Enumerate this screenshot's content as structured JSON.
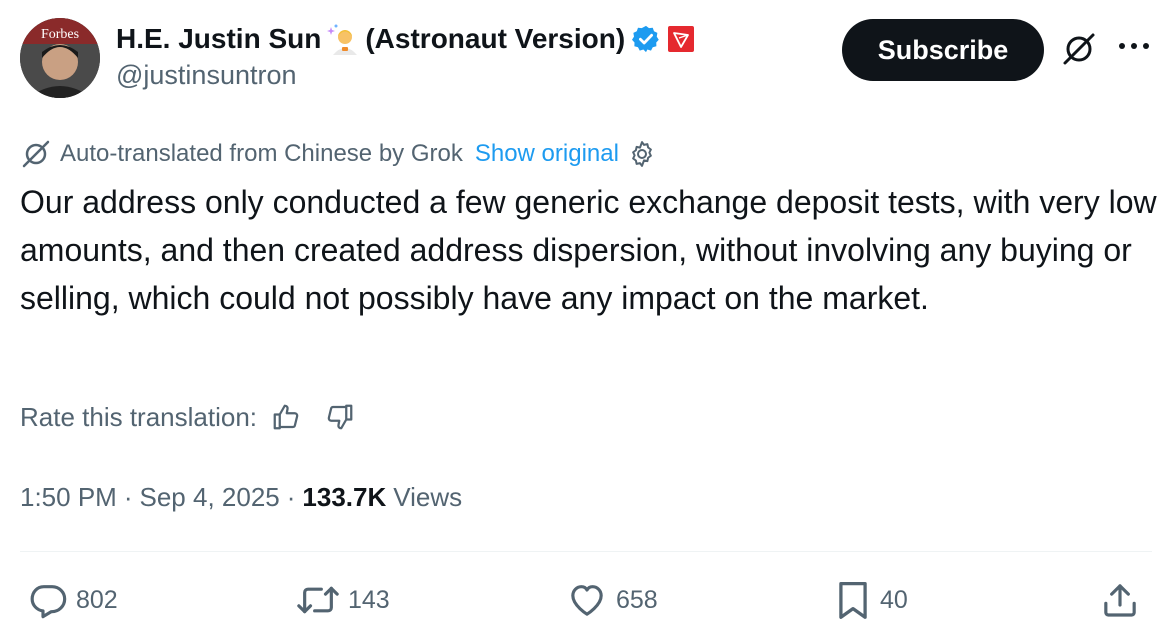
{
  "author": {
    "name": "H.E. Justin Sun",
    "name_suffix": "(Astronaut Version)",
    "handle": "@justinsuntron",
    "avatar_text": "Forbes",
    "verified_color": "#1d9bf0",
    "badge_color": "#e5292f",
    "emoji_icon": "astronaut-emoji-icon"
  },
  "header": {
    "subscribe_label": "Subscribe"
  },
  "translation": {
    "notice": "Auto-translated from Chinese by Grok",
    "show_original": "Show original",
    "rate_label": "Rate this translation:"
  },
  "tweet": {
    "text": "Our address only conducted a few generic exchange deposit tests, with very low amounts, and then created address dispersion, without involving any buying or selling, which could not possibly have any impact on the market.",
    "time": "1:50 PM",
    "date": "Sep 4, 2025",
    "separator": "·",
    "views_count": "133.7K",
    "views_label": "Views"
  },
  "actions": {
    "replies": "802",
    "reposts": "143",
    "likes": "658",
    "bookmarks": "40"
  },
  "colors": {
    "text_primary": "#0f1419",
    "text_secondary": "#536471",
    "link": "#1d9bf0"
  }
}
